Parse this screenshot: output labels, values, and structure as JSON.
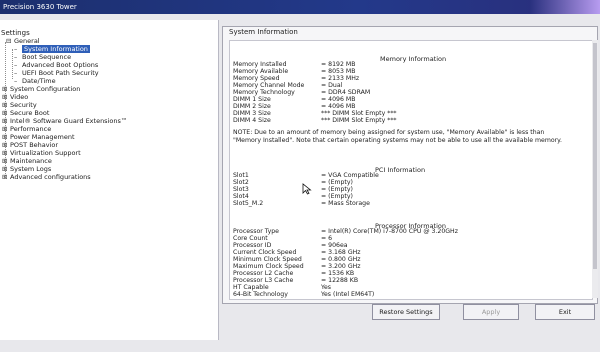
{
  "window": {
    "title": "Precision 3630 Tower"
  },
  "settings_tree": {
    "header": "Settings",
    "items": [
      {
        "label": "General",
        "expanded": true
      },
      {
        "label": "System Information",
        "selected": true
      },
      {
        "label": "Boot Sequence"
      },
      {
        "label": "Advanced Boot Options"
      },
      {
        "label": "UEFI Boot Path Security"
      },
      {
        "label": "Date/Time"
      },
      {
        "label": "System Configuration"
      },
      {
        "label": "Video"
      },
      {
        "label": "Security"
      },
      {
        "label": "Secure Boot"
      },
      {
        "label": "Intel® Software Guard Extensions™"
      },
      {
        "label": "Performance"
      },
      {
        "label": "Power Management"
      },
      {
        "label": "POST Behavior"
      },
      {
        "label": "Virtualization Support"
      },
      {
        "label": "Maintenance"
      },
      {
        "label": "System Logs"
      },
      {
        "label": "Advanced configurations"
      }
    ]
  },
  "panel": {
    "title": "System Information",
    "memory": {
      "heading": "Memory Information",
      "rows": [
        {
          "k": "Memory Installed",
          "v": "= 8192 MB"
        },
        {
          "k": "Memory Available",
          "v": "= 8053 MB"
        },
        {
          "k": "Memory Speed",
          "v": "= 2133 MHz"
        },
        {
          "k": "Memory Channel Mode",
          "v": "= Dual"
        },
        {
          "k": "Memory Technology",
          "v": "= DDR4 SDRAM"
        },
        {
          "k": "DIMM 1 Size",
          "v": "= 4096 MB"
        },
        {
          "k": "DIMM 2 Size",
          "v": "= 4096 MB"
        },
        {
          "k": "DIMM 3 Size",
          "v": "*** DIMM Slot Empty ***"
        },
        {
          "k": "DIMM 4 Size",
          "v": "*** DIMM Slot Empty ***"
        }
      ],
      "note": "NOTE: Due to an amount of memory being assigned for system use, \"Memory Available\" is less than \"Memory Installed\". Note that certain operating systems may not be able to use all the available memory."
    },
    "pci": {
      "heading": "PCI Information",
      "rows": [
        {
          "k": "Slot1",
          "v": "= VGA Compatible"
        },
        {
          "k": "Slot2",
          "v": "= (Empty)"
        },
        {
          "k": "Slot3",
          "v": "= (Empty)"
        },
        {
          "k": "Slot4",
          "v": "= (Empty)"
        },
        {
          "k": "Slot5_M.2",
          "v": "= Mass Storage"
        }
      ]
    },
    "processor": {
      "heading": "Processor Information",
      "rows": [
        {
          "k": "Processor Type",
          "v": "= Intel(R) Core(TM) i7-8700 CPU @ 3.20GHz"
        },
        {
          "k": "Core Count",
          "v": "= 6"
        },
        {
          "k": "Processor ID",
          "v": "= 906ea"
        },
        {
          "k": "Current Clock Speed",
          "v": "= 3.168 GHz"
        },
        {
          "k": "Minimum Clock Speed",
          "v": "= 0.800 GHz"
        },
        {
          "k": "Maximum Clock Speed",
          "v": "= 3.200 GHz"
        },
        {
          "k": "Processor L2 Cache",
          "v": "= 1536 KB"
        },
        {
          "k": "Processor L3 Cache",
          "v": "= 12288 KB"
        },
        {
          "k": "HT Capable",
          "v": "Yes"
        },
        {
          "k": "64-Bit Technology",
          "v": "Yes (Intel EM64T)"
        }
      ]
    }
  },
  "buttons": {
    "restore": "Restore Settings",
    "apply": "Apply",
    "exit": "Exit"
  }
}
